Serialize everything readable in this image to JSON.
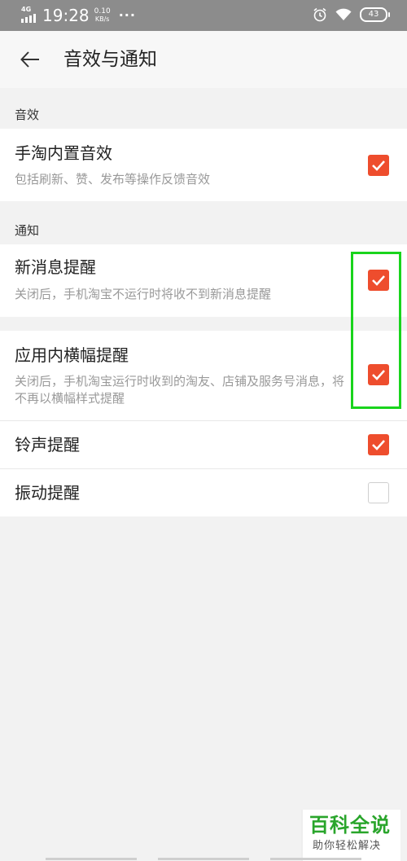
{
  "status_bar": {
    "network": "4G",
    "time": "19:28",
    "speed_value": "0.10",
    "speed_unit": "KB/s",
    "more": "···",
    "battery": "43"
  },
  "header": {
    "title": "音效与通知"
  },
  "sections": {
    "sound": {
      "label": "音效",
      "rows": [
        {
          "title": "手淘内置音效",
          "desc": "包括刷新、赞、发布等操作反馈音效",
          "checked": true
        }
      ]
    },
    "notify": {
      "label": "通知",
      "rows": [
        {
          "title": "新消息提醒",
          "desc": "关闭后，手机淘宝不运行时将收不到新消息提醒",
          "checked": true
        },
        {
          "title": "应用内横幅提醒",
          "desc": "关闭后，手机淘宝运行时收到的淘友、店铺及服务号消息，将不再以横幅样式提醒",
          "checked": true
        },
        {
          "title": "铃声提醒",
          "checked": true
        },
        {
          "title": "振动提醒",
          "checked": false
        }
      ]
    }
  },
  "watermark": {
    "main": "百科全说",
    "sub": "助你轻松解决"
  },
  "colors": {
    "accent": "#ee4d2d",
    "highlight": "#19d41c",
    "status_bar": "#8c8c8c"
  }
}
